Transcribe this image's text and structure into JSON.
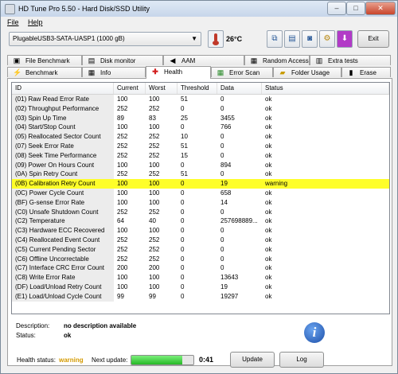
{
  "window": {
    "title": "HD Tune Pro 5.50 - Hard Disk/SSD Utility",
    "minimize_glyph": "–",
    "maximize_glyph": "□",
    "close_glyph": "✕"
  },
  "menu": {
    "file": "File",
    "help": "Help"
  },
  "toolbar": {
    "drive": "PlugableUSB3-SATA-UASP1 (1000 gB)",
    "temperature": "26°C",
    "exit_label": "Exit",
    "icons": [
      "copy-icon",
      "save-icon",
      "screenshot-icon",
      "options-icon",
      "download-icon"
    ]
  },
  "tabs": {
    "row1": [
      "File Benchmark",
      "Disk monitor",
      "AAM",
      "Random Access",
      "Extra tests"
    ],
    "row2": [
      "Benchmark",
      "Info",
      "Health",
      "Error Scan",
      "Folder Usage",
      "Erase"
    ],
    "active": "Health"
  },
  "table": {
    "columns": [
      "ID",
      "Current",
      "Worst",
      "Threshold",
      "Data",
      "Status"
    ],
    "rows": [
      [
        "(01) Raw Read Error Rate",
        "100",
        "100",
        "51",
        "0",
        "ok"
      ],
      [
        "(02) Throughput Performance",
        "252",
        "252",
        "0",
        "0",
        "ok"
      ],
      [
        "(03) Spin Up Time",
        "89",
        "83",
        "25",
        "3455",
        "ok"
      ],
      [
        "(04) Start/Stop Count",
        "100",
        "100",
        "0",
        "766",
        "ok"
      ],
      [
        "(05) Reallocated Sector Count",
        "252",
        "252",
        "10",
        "0",
        "ok"
      ],
      [
        "(07) Seek Error Rate",
        "252",
        "252",
        "51",
        "0",
        "ok"
      ],
      [
        "(08) Seek Time Performance",
        "252",
        "252",
        "15",
        "0",
        "ok"
      ],
      [
        "(09) Power On Hours Count",
        "100",
        "100",
        "0",
        "894",
        "ok"
      ],
      [
        "(0A) Spin Retry Count",
        "252",
        "252",
        "51",
        "0",
        "ok"
      ],
      [
        "(0B) Calibration Retry Count",
        "100",
        "100",
        "0",
        "19",
        "warning"
      ],
      [
        "(0C) Power Cycle Count",
        "100",
        "100",
        "0",
        "658",
        "ok"
      ],
      [
        "(BF) G-sense Error Rate",
        "100",
        "100",
        "0",
        "14",
        "ok"
      ],
      [
        "(C0) Unsafe Shutdown Count",
        "252",
        "252",
        "0",
        "0",
        "ok"
      ],
      [
        "(C2) Temperature",
        "64",
        "40",
        "0",
        "257698889...",
        "ok"
      ],
      [
        "(C3) Hardware ECC Recovered",
        "100",
        "100",
        "0",
        "0",
        "ok"
      ],
      [
        "(C4) Reallocated Event Count",
        "252",
        "252",
        "0",
        "0",
        "ok"
      ],
      [
        "(C5) Current Pending Sector",
        "252",
        "252",
        "0",
        "0",
        "ok"
      ],
      [
        "(C6) Offline Uncorrectable",
        "252",
        "252",
        "0",
        "0",
        "ok"
      ],
      [
        "(C7) Interface CRC Error Count",
        "200",
        "200",
        "0",
        "0",
        "ok"
      ],
      [
        "(C8) Write Error Rate",
        "100",
        "100",
        "0",
        "13643",
        "ok"
      ],
      [
        "(DF) Load/Unload Retry Count",
        "100",
        "100",
        "0",
        "19",
        "ok"
      ],
      [
        "(E1) Load/Unload Cycle Count",
        "99",
        "99",
        "0",
        "19297",
        "ok"
      ]
    ],
    "highlight_row": 9
  },
  "description": {
    "desc_label": "Description:",
    "desc_value": "no description available",
    "status_label": "Status:",
    "status_value": "ok"
  },
  "footer": {
    "health_label": "Health status:",
    "health_value": "warning",
    "next_update_label": "Next update:",
    "progress_fraction": 0.82,
    "time": "0:41",
    "update_label": "Update",
    "log_label": "Log"
  },
  "colors": {
    "warning_row": "#fefe2a",
    "health_warning_text": "#d49a00",
    "progress_fill": "#25b925"
  }
}
